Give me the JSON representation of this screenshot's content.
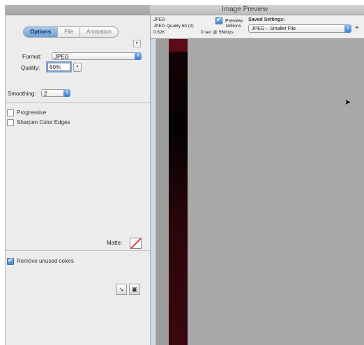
{
  "window": {
    "title": "Image Preview"
  },
  "tabs": [
    {
      "label": "Options"
    },
    {
      "label": "File"
    },
    {
      "label": "Animation"
    }
  ],
  "format": {
    "label": "Format:",
    "value": "JPEG"
  },
  "quality": {
    "label": "Quality:",
    "value": "60%"
  },
  "smoothing": {
    "label": "Smoothing:",
    "value": "2"
  },
  "options": {
    "progressive": {
      "label": "Progressive",
      "checked": false
    },
    "sharpen": {
      "label": "Sharpen Color Edges",
      "checked": false
    }
  },
  "matte": {
    "label": "Matte:"
  },
  "remove_unused": {
    "label": "Remove unused colors",
    "checked": true
  },
  "preview_info": {
    "format": "JPEG",
    "quality_line": "JPEG Quality 60 (2)",
    "size": "0.62K",
    "color_mode": "Millions",
    "download_time": "0 sec @ 56kbps",
    "preview_label": "Preview",
    "preview_checked": true,
    "saved_settings_label": "Saved Settings:",
    "saved_settings_value": "JPEG – Smaller File"
  },
  "colors": {
    "accent": "#5a8fd6",
    "image_bar": "#1a0205",
    "matte_line": "#e0303a"
  }
}
